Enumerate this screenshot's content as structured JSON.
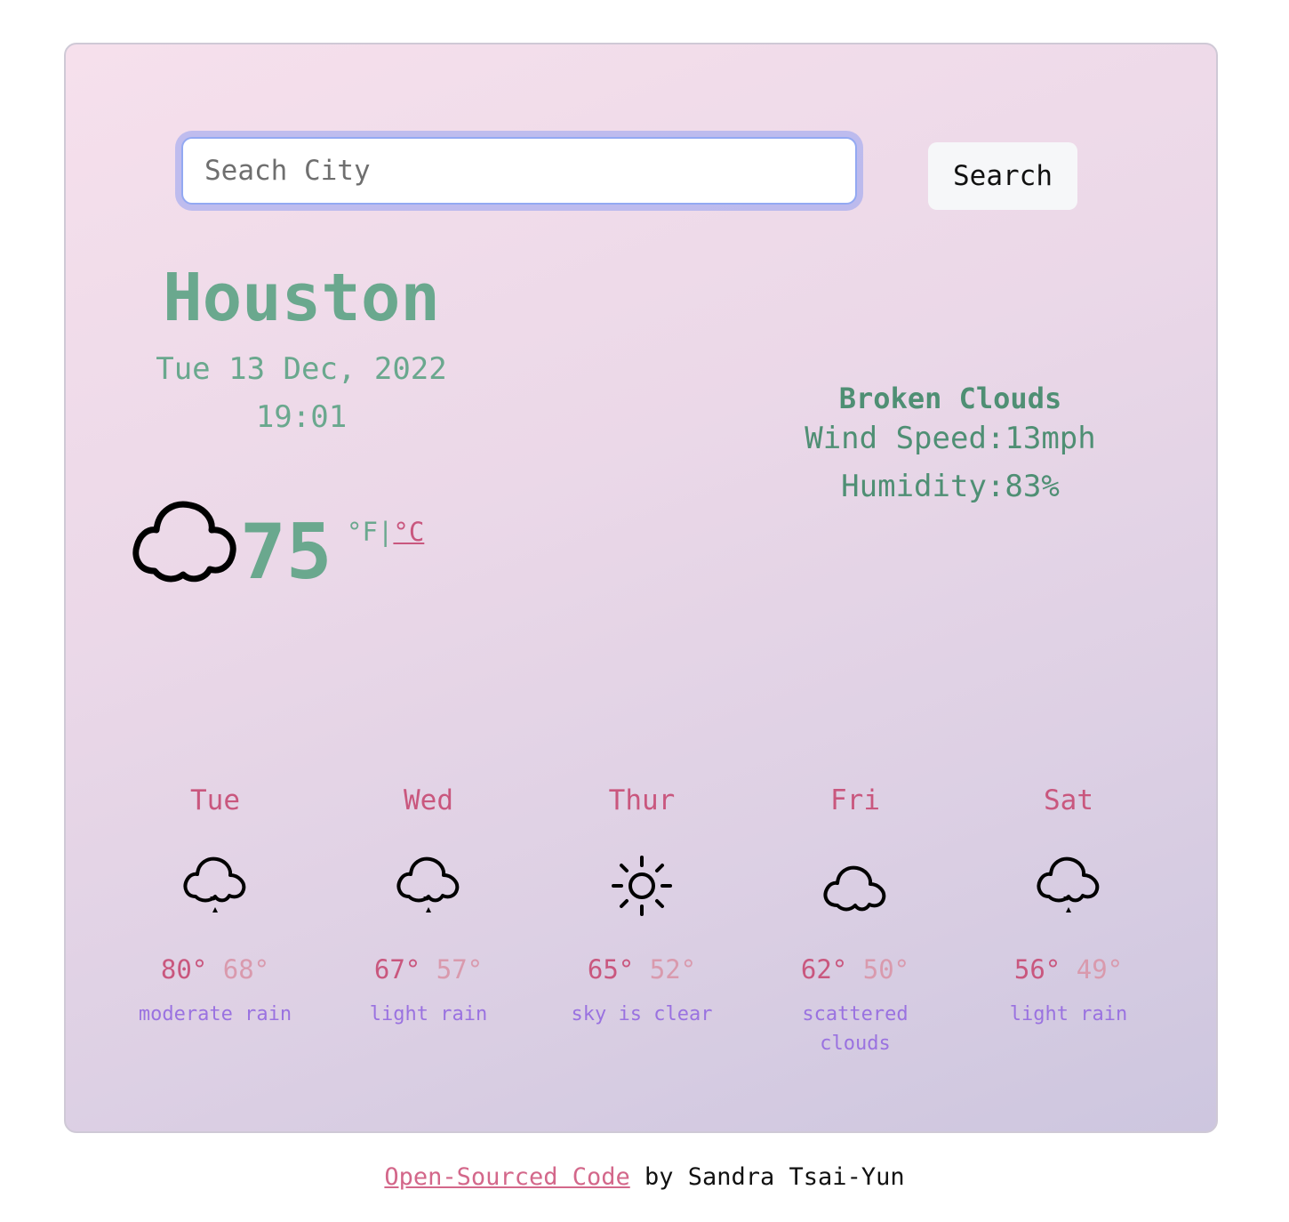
{
  "search": {
    "placeholder": "Seach City",
    "button_label": "Search"
  },
  "current": {
    "city": "Houston",
    "date": "Tue 13 Dec, 2022",
    "time": "19:01",
    "icon": "cloud-icon",
    "temperature": "75",
    "unit_f": "°F",
    "unit_separator": "|",
    "unit_c": "°C",
    "description": "Broken Clouds",
    "wind": "Wind Speed:13mph",
    "humidity": "Humidity:83%"
  },
  "forecast": [
    {
      "day": "Tue",
      "icon": "rain-cloud-icon",
      "max": "80°",
      "min": "68°",
      "description": "moderate rain"
    },
    {
      "day": "Wed",
      "icon": "rain-cloud-icon",
      "max": "67°",
      "min": "57°",
      "description": "light rain"
    },
    {
      "day": "Thur",
      "icon": "sun-icon",
      "max": "65°",
      "min": "52°",
      "description": "sky is clear"
    },
    {
      "day": "Fri",
      "icon": "cloud-icon",
      "max": "62°",
      "min": "50°",
      "description": "scattered clouds"
    },
    {
      "day": "Sat",
      "icon": "rain-cloud-icon",
      "max": "56°",
      "min": "49°",
      "description": "light rain"
    }
  ],
  "footer": {
    "link_text": "Open-Sourced Code",
    "author_text": " by Sandra Tsai-Yun"
  },
  "colors": {
    "accent_green": "#6aa88e",
    "accent_pink": "#c9577e",
    "accent_purple": "#9a72e0"
  }
}
